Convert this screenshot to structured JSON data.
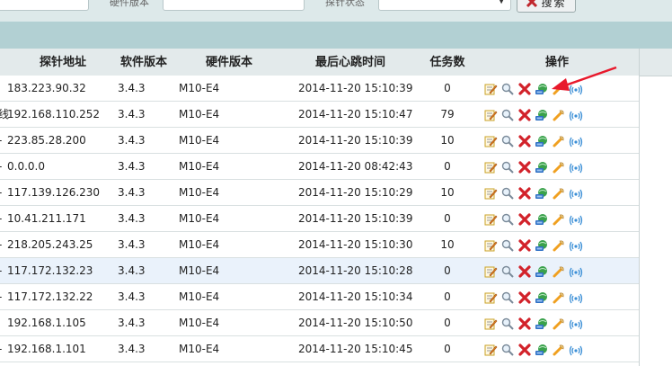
{
  "search": {
    "software_version_label": "硬件版本",
    "status_label": "探针状态",
    "search_button": "搜索"
  },
  "table": {
    "headers": {
      "address": "探针地址",
      "software": "软件版本",
      "hardware": "硬件版本",
      "heartbeat": "最后心跳时间",
      "tasks": "任务数",
      "ops": "操作"
    },
    "rows": [
      {
        "prefix": "",
        "address": "183.223.90.32",
        "software": "3.4.3",
        "hardware": "M10-E4",
        "heartbeat": "2014-11-20 15:10:39",
        "tasks": "0"
      },
      {
        "prefix": "线",
        "address": "192.168.110.252",
        "software": "3.4.3",
        "hardware": "M10-E4",
        "heartbeat": "2014-11-20 15:10:47",
        "tasks": "79"
      },
      {
        "prefix": "-",
        "address": "223.85.28.200",
        "software": "3.4.3",
        "hardware": "M10-E4",
        "heartbeat": "2014-11-20 15:10:39",
        "tasks": "10"
      },
      {
        "prefix": "-",
        "address": "0.0.0.0",
        "software": "3.4.3",
        "hardware": "M10-E4",
        "heartbeat": "2014-11-20 08:42:43",
        "tasks": "0"
      },
      {
        "prefix": "-",
        "address": "117.139.126.230",
        "software": "3.4.3",
        "hardware": "M10-E4",
        "heartbeat": "2014-11-20 15:10:29",
        "tasks": "10"
      },
      {
        "prefix": "-",
        "address": "10.41.211.171",
        "software": "3.4.3",
        "hardware": "M10-E4",
        "heartbeat": "2014-11-20 15:10:39",
        "tasks": "0"
      },
      {
        "prefix": "-",
        "address": "218.205.243.25",
        "software": "3.4.3",
        "hardware": "M10-E4",
        "heartbeat": "2014-11-20 15:10:30",
        "tasks": "10"
      },
      {
        "prefix": "-",
        "address": "117.172.132.23",
        "software": "3.4.3",
        "hardware": "M10-E4",
        "heartbeat": "2014-11-20 15:10:28",
        "tasks": "0"
      },
      {
        "prefix": "-",
        "address": "117.172.132.22",
        "software": "3.4.3",
        "hardware": "M10-E4",
        "heartbeat": "2014-11-20 15:10:34",
        "tasks": "0"
      },
      {
        "prefix": "",
        "address": "192.168.1.105",
        "software": "3.4.3",
        "hardware": "M10-E4",
        "heartbeat": "2014-11-20 15:10:50",
        "tasks": "0"
      },
      {
        "prefix": "-",
        "address": "192.168.1.101",
        "software": "3.4.3",
        "hardware": "M10-E4",
        "heartbeat": "2014-11-20 15:10:45",
        "tasks": "0"
      }
    ],
    "highlighted_row": 7,
    "row_ops": [
      "edit-icon",
      "view-icon",
      "delete-icon",
      "network-config-icon",
      "debug-icon",
      "signal-icon"
    ]
  },
  "colors": {
    "teal_bar": "#b2d0d3",
    "header_bg": "#e3eaeb",
    "row_highlight": "#eaf2fb",
    "annotation_arrow": "#e8192c"
  }
}
